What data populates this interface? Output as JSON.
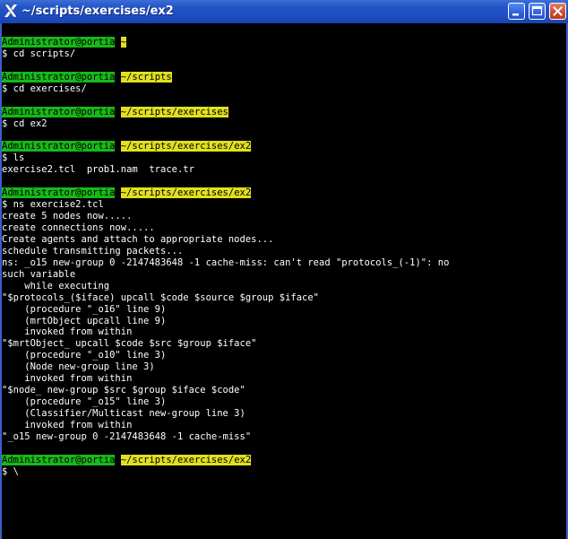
{
  "window": {
    "title": "~/scripts/exercises/ex2"
  },
  "terminal": {
    "lines": [
      {
        "type": "prompt",
        "user": "Administrator@portia",
        "path": "~"
      },
      {
        "type": "text",
        "text": "$ cd scripts/"
      },
      {
        "type": "text",
        "text": ""
      },
      {
        "type": "prompt",
        "user": "Administrator@portia",
        "path": "~/scripts"
      },
      {
        "type": "text",
        "text": "$ cd exercises/"
      },
      {
        "type": "text",
        "text": ""
      },
      {
        "type": "prompt",
        "user": "Administrator@portia",
        "path": "~/scripts/exercises"
      },
      {
        "type": "text",
        "text": "$ cd ex2"
      },
      {
        "type": "text",
        "text": ""
      },
      {
        "type": "prompt",
        "user": "Administrator@portia",
        "path": "~/scripts/exercises/ex2"
      },
      {
        "type": "text",
        "text": "$ ls"
      },
      {
        "type": "text",
        "text": "exercise2.tcl  prob1.nam  trace.tr"
      },
      {
        "type": "text",
        "text": ""
      },
      {
        "type": "prompt",
        "user": "Administrator@portia",
        "path": "~/scripts/exercises/ex2"
      },
      {
        "type": "text",
        "text": "$ ns exercise2.tcl"
      },
      {
        "type": "text",
        "text": "create 5 nodes now....."
      },
      {
        "type": "text",
        "text": "create connections now....."
      },
      {
        "type": "text",
        "text": "Create agents and attach to appropriate nodes..."
      },
      {
        "type": "text",
        "text": "schedule transmitting packets..."
      },
      {
        "type": "text",
        "text": "ns: _o15 new-group 0 -2147483648 -1 cache-miss: can't read \"protocols_(-1)\": no"
      },
      {
        "type": "text",
        "text": "such variable"
      },
      {
        "type": "text",
        "text": "    while executing"
      },
      {
        "type": "text",
        "text": "\"$protocols_($iface) upcall $code $source $group $iface\""
      },
      {
        "type": "text",
        "text": "    (procedure \"_o16\" line 9)"
      },
      {
        "type": "text",
        "text": "    (mrtObject upcall line 9)"
      },
      {
        "type": "text",
        "text": "    invoked from within"
      },
      {
        "type": "text",
        "text": "\"$mrtObject_ upcall $code $src $group $iface\""
      },
      {
        "type": "text",
        "text": "    (procedure \"_o10\" line 3)"
      },
      {
        "type": "text",
        "text": "    (Node new-group line 3)"
      },
      {
        "type": "text",
        "text": "    invoked from within"
      },
      {
        "type": "text",
        "text": "\"$node_ new-group $src $group $iface $code\""
      },
      {
        "type": "text",
        "text": "    (procedure \"_o15\" line 3)"
      },
      {
        "type": "text",
        "text": "    (Classifier/Multicast new-group line 3)"
      },
      {
        "type": "text",
        "text": "    invoked from within"
      },
      {
        "type": "text",
        "text": "\"_o15 new-group 0 -2147483648 -1 cache-miss\""
      },
      {
        "type": "text",
        "text": ""
      },
      {
        "type": "prompt",
        "user": "Administrator@portia",
        "path": "~/scripts/exercises/ex2"
      },
      {
        "type": "text",
        "text": "$ \\"
      }
    ]
  },
  "colors": {
    "titlebar": "#2554c7",
    "terminal_bg": "#000000",
    "terminal_fg": "#ffffff",
    "prompt_user_bg": "#18b818",
    "prompt_path_bg": "#e0e020"
  },
  "icons": {
    "app": "x-logo-icon",
    "minimize": "minimize-icon",
    "maximize": "maximize-icon",
    "close": "close-icon"
  }
}
